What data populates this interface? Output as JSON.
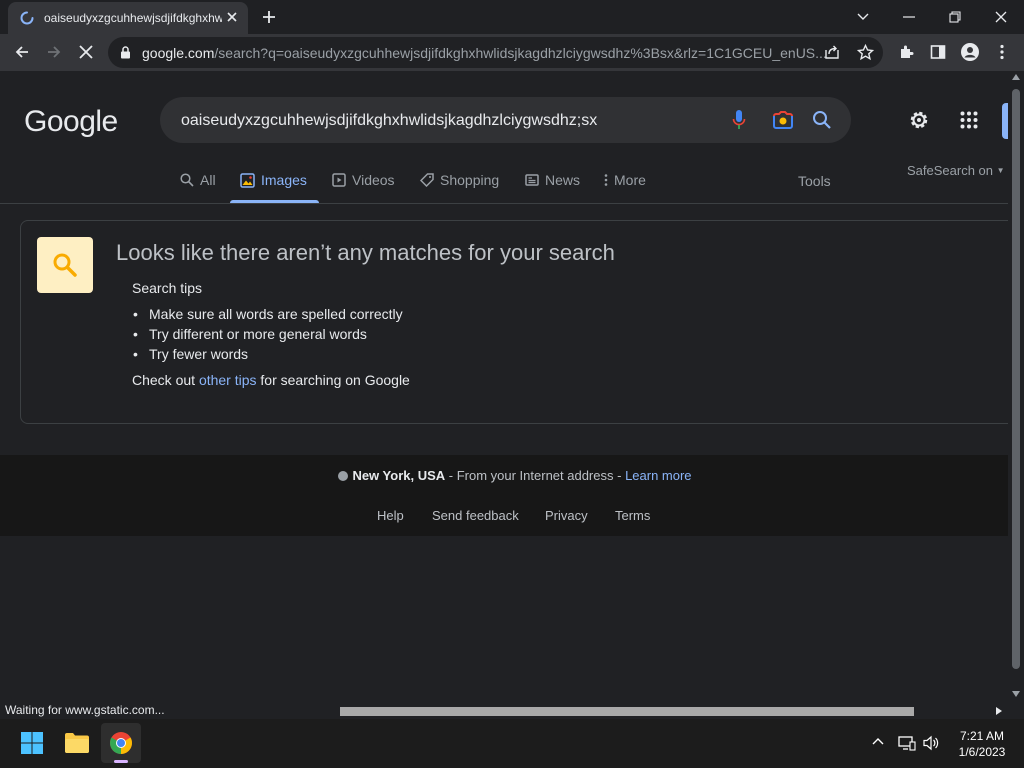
{
  "browser": {
    "tab_title": "oaiseudyxzgcuhhewjsdjifdkghxhw",
    "url_host": "google.com",
    "url_path": "/search?q=oaiseudyxzgcuhhewjsdjifdkghxhwlidsjkagdhzlciygwsdhz%3Bsx&rlz=1C1GCEU_enUS..."
  },
  "google": {
    "logo": "Google",
    "query": "oaiseudyxzgcuhhewjsdjifdkghxhwlidsjkagdhzlciygwsdhz;sx",
    "tabs": [
      "All",
      "Images",
      "Videos",
      "Shopping",
      "News",
      "More"
    ],
    "active_tab": "Images",
    "tools": "Tools",
    "safesearch": "SafeSearch on"
  },
  "no_results": {
    "title": "Looks like there aren’t any matches for your search",
    "tips_heading": "Search tips",
    "tips": [
      "Make sure all words are spelled correctly",
      "Try different or more general words",
      "Try fewer words"
    ],
    "checkout_prefix": "Check out ",
    "checkout_link": "other tips",
    "checkout_suffix": " for searching on Google"
  },
  "footer": {
    "location": "New York, USA",
    "location_source": " - From your Internet address - ",
    "learn_more": "Learn more",
    "links": [
      "Help",
      "Send feedback",
      "Privacy",
      "Terms"
    ]
  },
  "status_bar": "Waiting for www.gstatic.com...",
  "taskbar": {
    "time": "7:21 AM",
    "date": "1/6/2023"
  },
  "colors": {
    "background": "#202124",
    "link": "#8ab4f8",
    "active_tab": "#8ab4f8"
  }
}
